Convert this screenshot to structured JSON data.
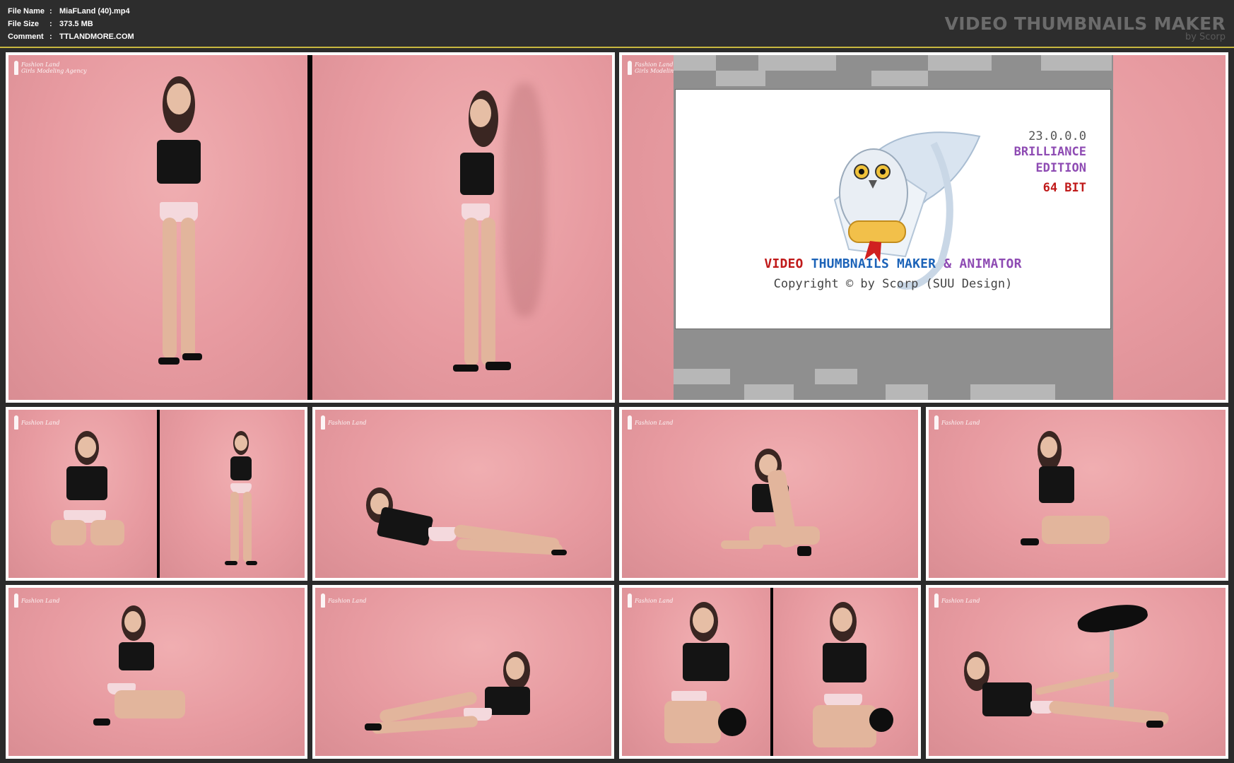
{
  "info": {
    "file_name_label": "File Name",
    "file_name_value": "MiaFLand (40).mp4",
    "file_size_label": "File Size",
    "file_size_value": "373.5 MB",
    "comment_label": "Comment",
    "comment_value": "TTLANDMORE.COM",
    "separator": ":"
  },
  "brand": {
    "title": "VIDEO THUMBNAILS MAKER",
    "subtitle": "by Scorp"
  },
  "splash": {
    "version": "23.0.0.0",
    "edition_line1": "BRILLIANCE",
    "edition_line2": "EDITION",
    "bits": "64 BIT",
    "title_word1": "VIDEO",
    "title_word2": "THUMBNAILS MAKER",
    "title_word3": "& ANIMATOR",
    "copyright": "Copyright © by Scorp (SUU Design)"
  },
  "watermark": {
    "line1": "Fashion Land",
    "line2": "Girls Modeling Agency"
  },
  "colors": {
    "background": "#2b2b2b",
    "separator": "#c7b73f",
    "backdrop_pink": "#e9a2a5",
    "frame_border": "#ffffff"
  }
}
